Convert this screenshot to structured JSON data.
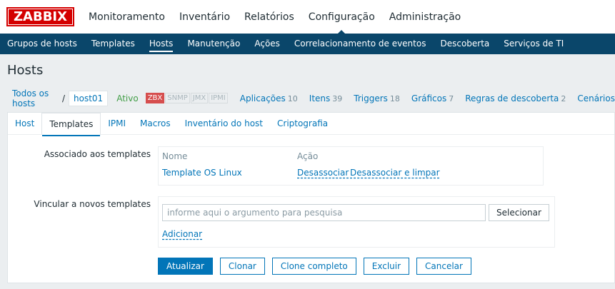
{
  "logo": "ZABBIX",
  "top_menu": [
    "Monitoramento",
    "Inventário",
    "Relatórios",
    "Configuração",
    "Administração"
  ],
  "top_menu_active": "Configuração",
  "sub_menu": [
    "Grupos de hosts",
    "Templates",
    "Hosts",
    "Manutenção",
    "Ações",
    "Correlacionamento de eventos",
    "Descoberta",
    "Serviços de TI"
  ],
  "sub_menu_active": "Hosts",
  "page_title": "Hosts",
  "hostbar": {
    "all_hosts": "Todos os hosts",
    "sep": "/",
    "host": "host01",
    "status": "Ativo",
    "availability": [
      "ZBX",
      "SNMP",
      "JMX",
      "IPMI"
    ],
    "links": [
      {
        "label": "Aplicações",
        "count": "10"
      },
      {
        "label": "Itens",
        "count": "39"
      },
      {
        "label": "Triggers",
        "count": "18"
      },
      {
        "label": "Gráficos",
        "count": "7"
      },
      {
        "label": "Regras de descoberta",
        "count": "2"
      },
      {
        "label": "Cenários",
        "count": ""
      }
    ]
  },
  "tabs": [
    "Host",
    "Templates",
    "IPMI",
    "Macros",
    "Inventário do host",
    "Criptografia"
  ],
  "tab_active": "Templates",
  "form": {
    "linked_label": "Associado aos templates",
    "col_name": "Nome",
    "col_action": "Ação",
    "template_name": "Template OS Linux",
    "unlink": "Desassociar",
    "unlink_clear": "Desassociar e limpar",
    "link_new_label": "Vincular a novos templates",
    "search_placeholder": "informe aqui o argumento para pesquisa",
    "select_button": "Selecionar",
    "add_link": "Adicionar"
  },
  "buttons": {
    "update": "Atualizar",
    "clone": "Clonar",
    "full_clone": "Clone completo",
    "delete": "Excluir",
    "cancel": "Cancelar"
  },
  "colors": {
    "brand_red": "#d40000",
    "nav_blue": "#0a466a",
    "link_blue": "#0275b8",
    "status_green": "#429e47"
  }
}
